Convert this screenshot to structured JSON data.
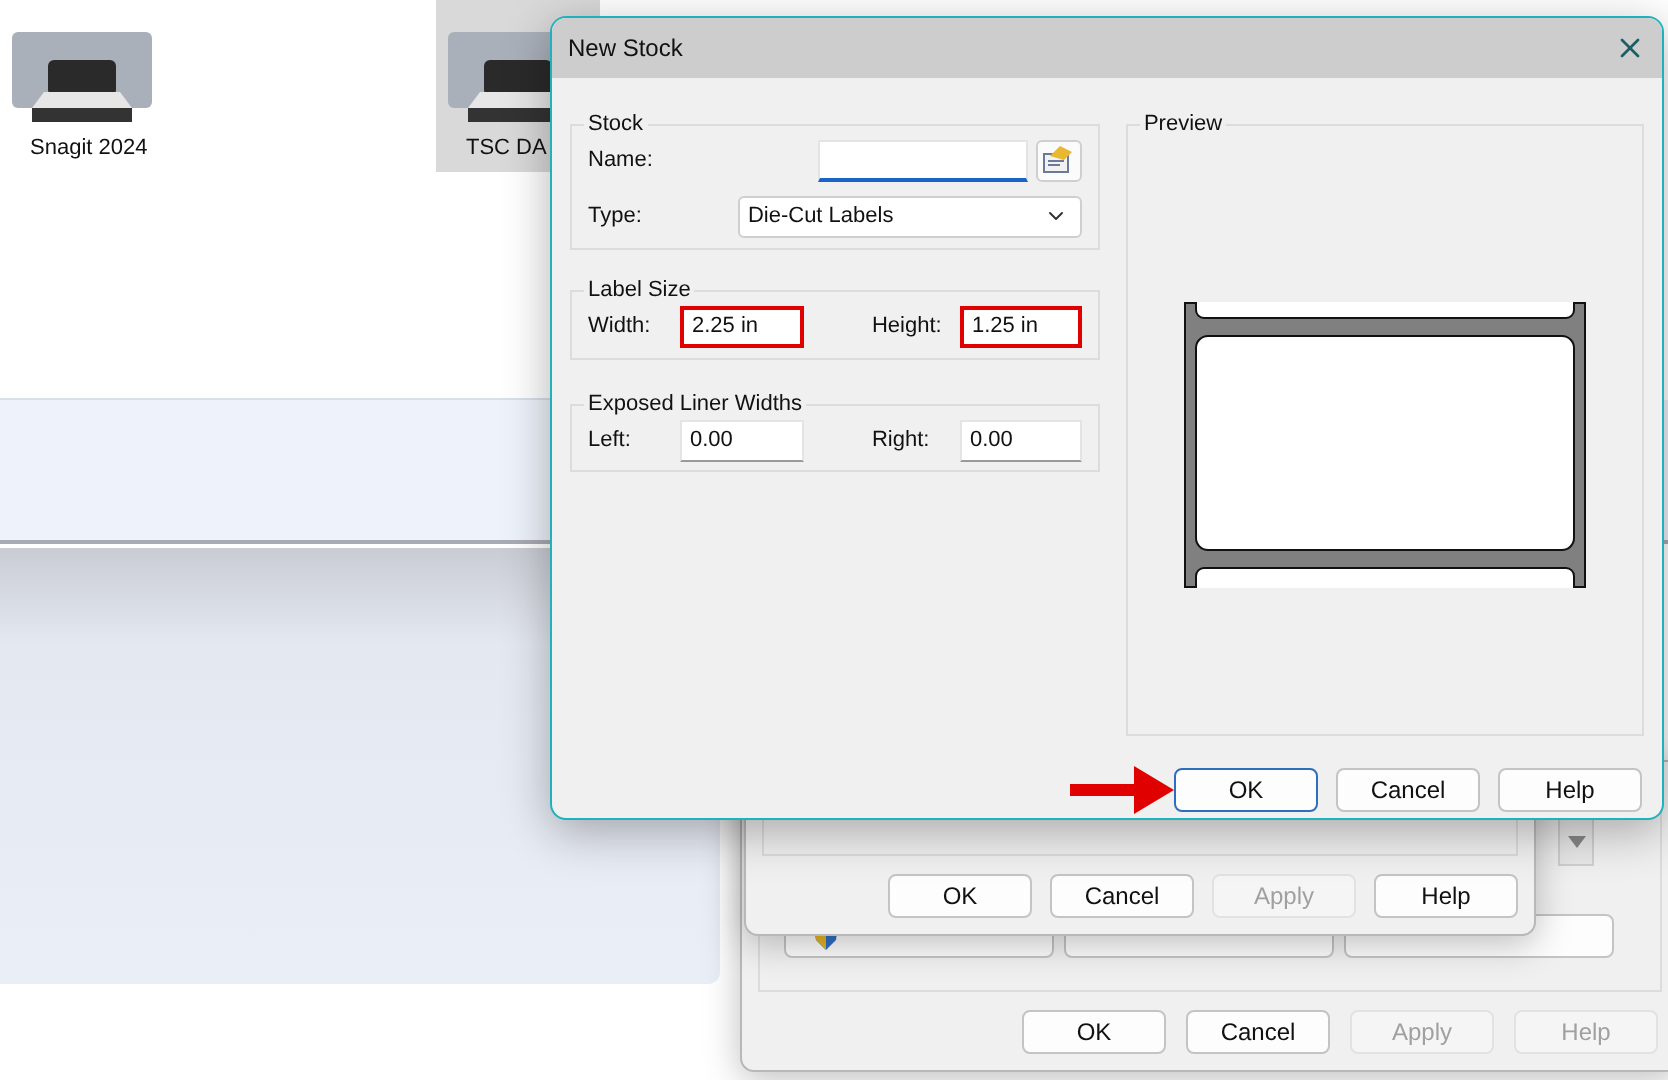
{
  "desktop": {
    "items": [
      {
        "label": "Snagit 2024",
        "selected": false
      },
      {
        "label": "TSC DA",
        "selected": true
      }
    ]
  },
  "printer_window": {
    "buttons": [
      {
        "label": "OK",
        "disabled": false
      },
      {
        "label": "Cancel",
        "disabled": false
      },
      {
        "label": "Apply",
        "disabled": true
      },
      {
        "label": "Help",
        "disabled": true
      }
    ]
  },
  "properties_window": {
    "buttons": [
      {
        "label": "OK",
        "disabled": false
      },
      {
        "label": "Cancel",
        "disabled": false
      },
      {
        "label": "Apply",
        "disabled": true
      },
      {
        "label": "Help",
        "disabled": false
      }
    ]
  },
  "dialog": {
    "title": "New Stock",
    "stock": {
      "title": "Stock",
      "name": {
        "label": "Name:",
        "focused": true
      },
      "type": {
        "label": "Type:",
        "value": "Die-Cut Labels"
      }
    },
    "label_size": {
      "title": "Label Size",
      "fields": [
        {
          "label": "Width:",
          "value": "2.25 in",
          "highlighted": true
        },
        {
          "label": "Height:",
          "value": "1.25 in",
          "highlighted": true
        }
      ]
    },
    "liner": {
      "title": "Exposed Liner Widths",
      "fields": [
        {
          "label": "Left:",
          "value": "0.00",
          "highlighted": false
        },
        {
          "label": "Right:",
          "value": "0.00",
          "highlighted": false
        }
      ]
    },
    "preview": {
      "title": "Preview"
    },
    "buttons": [
      {
        "label": "OK",
        "default": true,
        "pointed": true
      },
      {
        "label": "Cancel",
        "default": false,
        "pointed": false
      },
      {
        "label": "Help",
        "default": false,
        "pointed": false
      }
    ]
  }
}
